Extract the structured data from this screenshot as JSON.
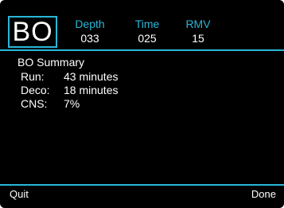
{
  "header": {
    "mode": "BO",
    "stats": [
      {
        "label": "Depth",
        "value": "033"
      },
      {
        "label": "Time",
        "value": "025"
      },
      {
        "label": "RMV",
        "value": "15"
      }
    ]
  },
  "summary": {
    "title": "BO Summary",
    "rows": [
      {
        "label": "Run:",
        "value": "43 minutes"
      },
      {
        "label": "Deco:",
        "value": "18 minutes"
      },
      {
        "label": "CNS:",
        "value": "7%"
      }
    ]
  },
  "softkeys": {
    "left": "Quit",
    "right": "Done"
  },
  "colors": {
    "accent": "#29b6d9",
    "background": "#000000",
    "text": "#ffffff"
  }
}
